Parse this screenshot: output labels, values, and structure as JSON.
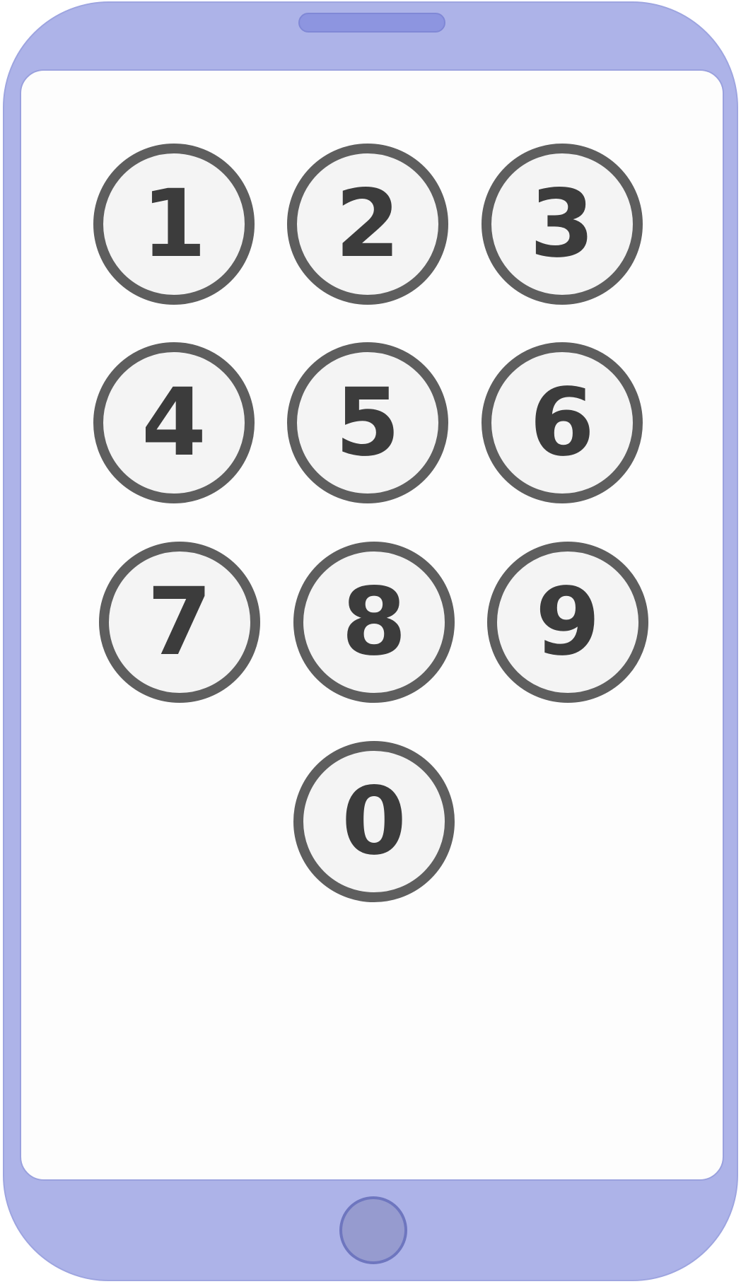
{
  "keypad": {
    "keys": [
      {
        "label": "1"
      },
      {
        "label": "2"
      },
      {
        "label": "3"
      },
      {
        "label": "4"
      },
      {
        "label": "5"
      },
      {
        "label": "6"
      },
      {
        "label": "7"
      },
      {
        "label": "8"
      },
      {
        "label": "9"
      },
      {
        "label": "0"
      }
    ]
  },
  "colors": {
    "phone_body": "#adb3e8",
    "screen": "#fdfdfd",
    "key_fill": "#f4f4f4",
    "key_border": "#5e5e5e",
    "key_text": "#3c3c3c",
    "home_button": "#969bcf"
  }
}
